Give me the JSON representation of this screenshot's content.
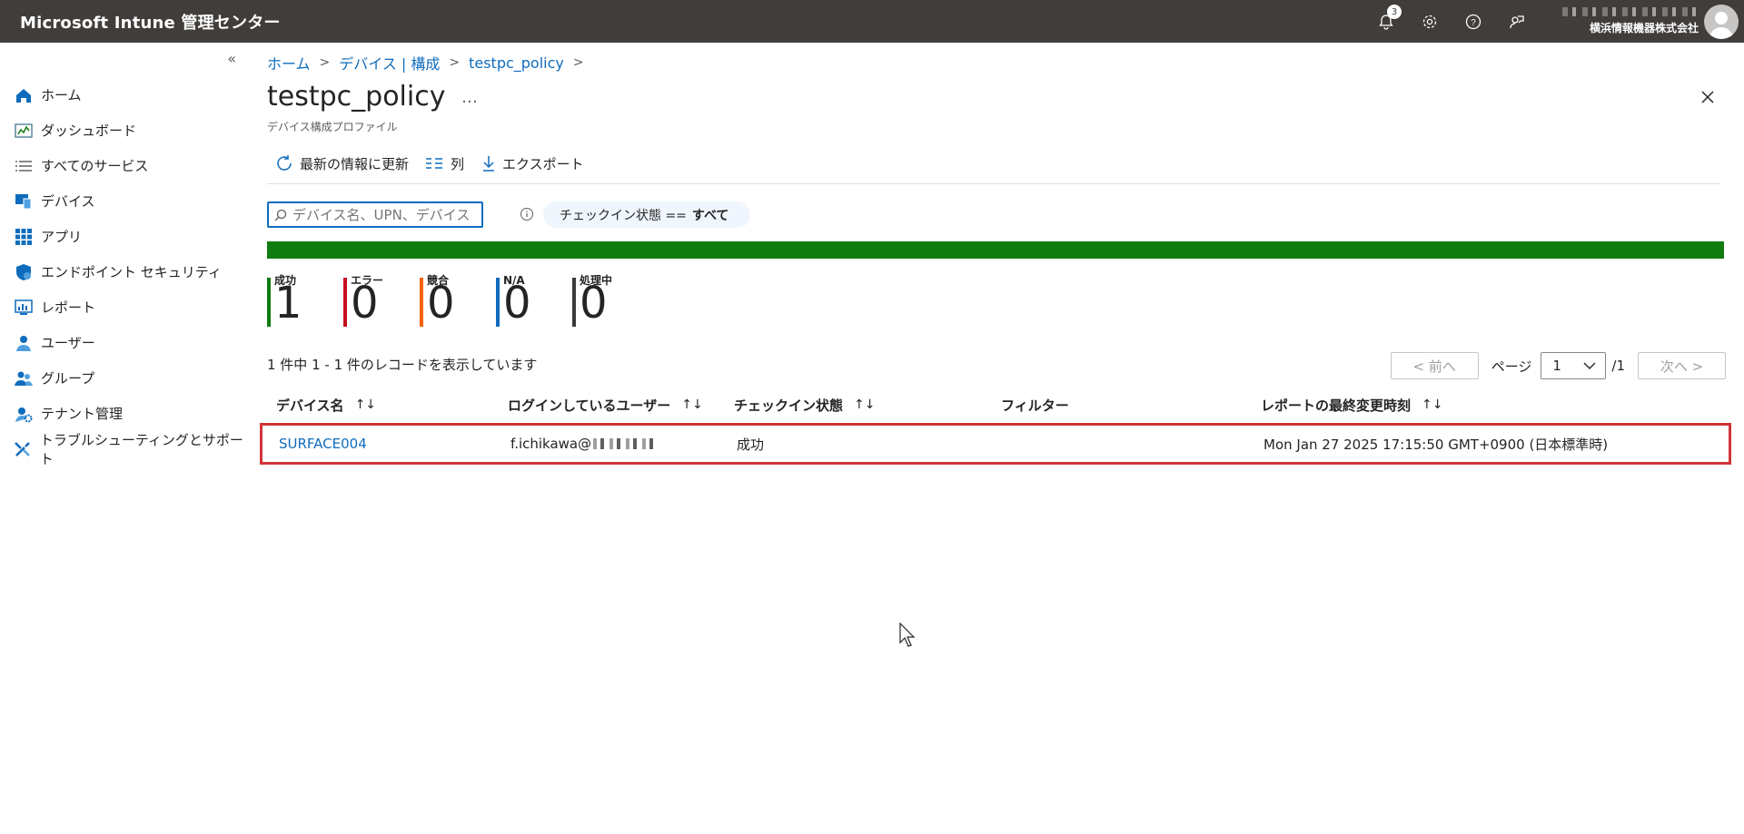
{
  "header": {
    "app_title": "Microsoft Intune 管理センター",
    "notification_count": "3",
    "org_name": "横浜情報機器株式会社"
  },
  "sidebar": {
    "collapse_label": "«",
    "items": [
      {
        "label": "ホーム",
        "icon": "home-icon"
      },
      {
        "label": "ダッシュボード",
        "icon": "dashboard-icon"
      },
      {
        "label": "すべてのサービス",
        "icon": "list-icon"
      },
      {
        "label": "デバイス",
        "icon": "device-icon"
      },
      {
        "label": "アプリ",
        "icon": "apps-grid-icon"
      },
      {
        "label": "エンドポイント セキュリティ",
        "icon": "shield-icon"
      },
      {
        "label": "レポート",
        "icon": "report-icon"
      },
      {
        "label": "ユーザー",
        "icon": "user-icon"
      },
      {
        "label": "グループ",
        "icon": "group-icon"
      },
      {
        "label": "テナント管理",
        "icon": "tenant-icon"
      },
      {
        "label": "トラブルシューティングとサポート",
        "icon": "wrench-icon"
      }
    ]
  },
  "breadcrumb": [
    "ホーム",
    "デバイス | 構成",
    "testpc_policy"
  ],
  "page": {
    "title": "testpc_policy",
    "more": "…",
    "subtitle": "デバイス構成プロファイル"
  },
  "toolbar": {
    "refresh": "最新の情報に更新",
    "columns": "列",
    "export": "エクスポート"
  },
  "search": {
    "placeholder": "デバイス名、UPN、デバイス ID て"
  },
  "filter": {
    "label": "チェックイン状態 ==",
    "value": "すべて"
  },
  "progress": {
    "success_fraction": 1.0,
    "color": "#107c10"
  },
  "summary": [
    {
      "label": "成功",
      "value": "1",
      "color": "#107c10"
    },
    {
      "label": "エラー",
      "value": "0",
      "color": "#c50f1f"
    },
    {
      "label": "競合",
      "value": "0",
      "color": "#f7630c"
    },
    {
      "label": "N/A",
      "value": "0",
      "color": "#0f6cbd"
    },
    {
      "label": "処理中",
      "value": "0",
      "color": "#3b3a39"
    }
  ],
  "records": {
    "count_text": "1 件中 1 - 1 件のレコードを表示しています"
  },
  "pager": {
    "prev": "< 前へ",
    "page_label": "ページ",
    "current": "1",
    "total": "/1",
    "next": "次へ >"
  },
  "table": {
    "columns": [
      "デバイス名",
      "ログインしているユーザー",
      "チェックイン状態",
      "フィルター",
      "レポートの最終変更時刻"
    ],
    "sort_glyph": "↑↓",
    "rows": [
      {
        "device": "SURFACE004",
        "user": "f.ichikawa@",
        "status": "成功",
        "filter": "",
        "modified": "Mon Jan 27 2025 17:15:50 GMT+0900 (日本標準時)"
      }
    ]
  }
}
